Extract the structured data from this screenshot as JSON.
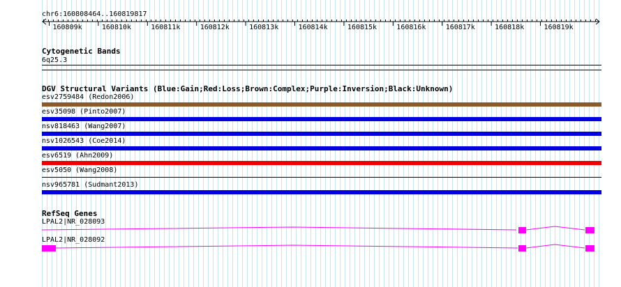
{
  "ruler": {
    "location": "chr6:160808464..160819817",
    "ticks": [
      "160809k",
      "160810k",
      "160811k",
      "160812k",
      "160813k",
      "160814k",
      "160815k",
      "160816k",
      "160817k",
      "160818k",
      "160819k"
    ]
  },
  "cyto": {
    "title": "Cytogenetic Bands",
    "band": "6q25.3"
  },
  "dgv": {
    "title": "DGV Structural Variants (Blue:Gain;Red:Loss;Brown:Complex;Purple:Inversion;Black:Unknown)",
    "colors": {
      "gain": "#0000e0",
      "loss": "#ee0000",
      "complex": "#8b5a2b"
    },
    "variants": [
      {
        "label": "esv2759484 (Redon2006)",
        "type": "complex"
      },
      {
        "label": "esv35098 (Pinto2007)",
        "type": "gain"
      },
      {
        "label": "nsv818463 (Wang2007)",
        "type": "gain"
      },
      {
        "label": "nsv1026543 (Coe2014)",
        "type": "gain"
      },
      {
        "label": "esv6519 (Ahn2009)",
        "type": "loss"
      },
      {
        "label": "esv5050 (Wang2008)",
        "type": "none"
      },
      {
        "label": "nsv965781 (Sudmant2013)",
        "type": "gain"
      }
    ]
  },
  "refseq": {
    "title": "RefSeq Genes",
    "gene_color": "#ff00ff",
    "transcripts": [
      {
        "label": "LPAL2|NR_028093"
      },
      {
        "label": "LPAL2|NR_028092"
      }
    ]
  }
}
